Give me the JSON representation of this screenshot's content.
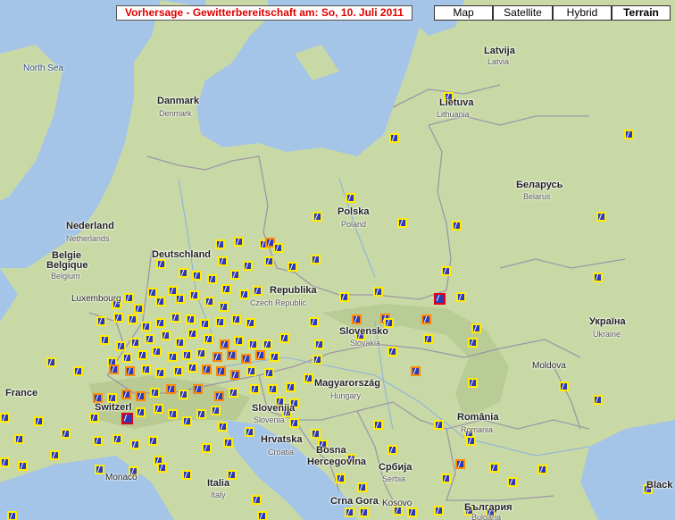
{
  "header": {
    "title": "Vorhersage - Gewitterbereitschaft am: So, 10. Juli 2011"
  },
  "map_types": [
    {
      "label": "Map",
      "active": false
    },
    {
      "label": "Satellite",
      "active": false
    },
    {
      "label": "Hybrid",
      "active": false
    },
    {
      "label": "Terrain",
      "active": true
    }
  ],
  "labels": {
    "north_sea": "North Sea",
    "denmark": "Danmark",
    "denmark_en": "Denmark",
    "latvija": "Latvija",
    "latvia": "Latvia",
    "lietuva": "Lietuva",
    "lithuania": "Lithuania",
    "belarus_local": "Беларусь",
    "belarus": "Belarus",
    "nederland": "Nederland",
    "netherlands": "Netherlands",
    "polska": "Polska",
    "poland": "Poland",
    "deutschland": "Deutschland",
    "belgie": "Belgie",
    "belgique": "Belgique",
    "belgium": "Belgium",
    "luxembourg": "Luxembourg",
    "republika": "Republika",
    "czech": "Czech Republic",
    "slovensko": "Slovensko",
    "slovakia": "Slovakia",
    "ukraina": "Україна",
    "ukraine": "Ukraine",
    "france": "France",
    "switzerland": "Switzerl",
    "magyarorszag": "Magyarország",
    "hungary": "Hungary",
    "moldova": "Moldova",
    "slovenija": "Slovenija",
    "slovenia": "Slovenia",
    "hrvatska": "Hrvatska",
    "croatia": "Croatia",
    "bosna": "Bosna",
    "hercegovina": "Hercegovina",
    "srbija": "Србија",
    "serbia": "Serbia",
    "romania": "România",
    "romania_en": "Romania",
    "monaco": "Monaco",
    "italia": "Italia",
    "italy": "Italy",
    "crna_gora": "Crna Gora",
    "kosovo": "Kosovo",
    "bulgaria_local": "България",
    "bulgaria": "Bulgaria",
    "black_sea": "Black S"
  },
  "colors": {
    "land": "#c9d9a6",
    "water": "#a4c4e8",
    "marker_fill": "#2d3ab3",
    "risk_low": "#ffec00",
    "risk_medium": "#ff8a00",
    "risk_high": "#e0001b",
    "title_text": "#e00000"
  }
}
